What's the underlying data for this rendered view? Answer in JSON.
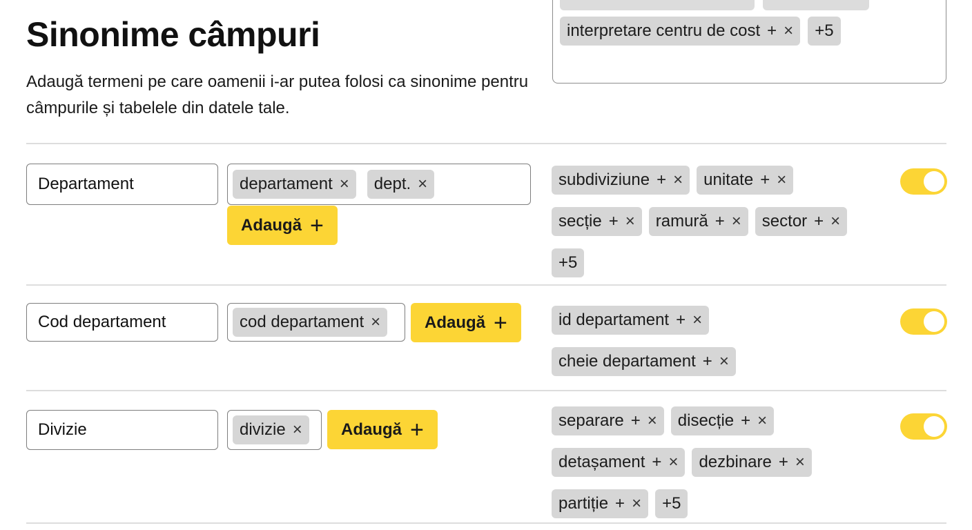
{
  "header": {
    "title": "Sinonime câmpuri",
    "subtitle": "Adaugă termeni pe care oamenii i-ar putea folosi ca sinonime pentru câmpurile și tabelele din datele tale."
  },
  "top_panel": {
    "chips": [
      {
        "label": "interpretare centru de cost",
        "suffix": "+",
        "close": "×"
      }
    ],
    "more": "+5"
  },
  "rows": [
    {
      "name": "Departament",
      "synonyms": [
        {
          "label": "departament",
          "close": "×"
        },
        {
          "label": "dept.",
          "close": "×"
        }
      ],
      "add_label": "Adaugă",
      "add_icon": "+",
      "suggestions": [
        {
          "label": "subdiviziune",
          "plus": "+",
          "close": "×"
        },
        {
          "label": "unitate",
          "plus": "+",
          "close": "×"
        },
        {
          "label": "secție",
          "plus": "+",
          "close": "×"
        },
        {
          "label": "ramură",
          "plus": "+",
          "close": "×"
        },
        {
          "label": "sector",
          "plus": "+",
          "close": "×"
        }
      ],
      "more": "+5",
      "enabled": true
    },
    {
      "name": "Cod departament",
      "synonyms": [
        {
          "label": "cod departament",
          "close": "×"
        }
      ],
      "add_label": "Adaugă",
      "add_icon": "+",
      "suggestions": [
        {
          "label": "id departament",
          "plus": "+",
          "close": "×"
        },
        {
          "label": "cheie departament",
          "plus": "+",
          "close": "×"
        }
      ],
      "more": "",
      "enabled": true
    },
    {
      "name": "Divizie",
      "synonyms": [
        {
          "label": "divizie",
          "close": "×"
        }
      ],
      "add_label": "Adaugă",
      "add_icon": "+",
      "suggestions": [
        {
          "label": "separare",
          "plus": "+",
          "close": "×"
        },
        {
          "label": "disecție",
          "plus": "+",
          "close": "×"
        },
        {
          "label": "detașament",
          "plus": "+",
          "close": "×"
        },
        {
          "label": "dezbinare",
          "plus": "+",
          "close": "×"
        },
        {
          "label": "partiție",
          "plus": "+",
          "close": "×"
        }
      ],
      "more": "+5",
      "enabled": true
    }
  ],
  "colors": {
    "accent": "#fcd535",
    "chip_bg": "#d6d6d6",
    "border": "#7d7d7d",
    "divider": "#dddddd"
  }
}
